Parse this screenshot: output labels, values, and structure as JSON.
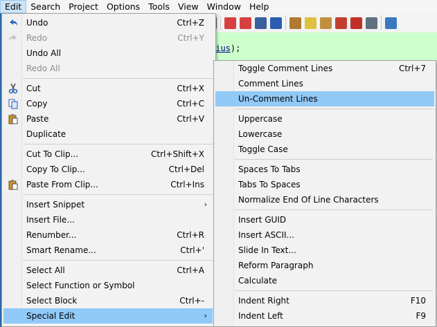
{
  "menubar": [
    "Edit",
    "Search",
    "Project",
    "Options",
    "Tools",
    "View",
    "Window",
    "Help"
  ],
  "editor": {
    "code_tail": "dius",
    "code_end": ");"
  },
  "edit_menu": {
    "undo": {
      "label": "Undo",
      "shortcut": "Ctrl+Z"
    },
    "redo": {
      "label": "Redo",
      "shortcut": "Ctrl+Y"
    },
    "undo_all": {
      "label": "Undo All"
    },
    "redo_all": {
      "label": "Redo All"
    },
    "cut": {
      "label": "Cut",
      "shortcut": "Ctrl+X"
    },
    "copy": {
      "label": "Copy",
      "shortcut": "Ctrl+C"
    },
    "paste": {
      "label": "Paste",
      "shortcut": "Ctrl+V"
    },
    "duplicate": {
      "label": "Duplicate"
    },
    "cut_to_clip": {
      "label": "Cut To Clip...",
      "shortcut": "Ctrl+Shift+X"
    },
    "copy_to_clip": {
      "label": "Copy To Clip...",
      "shortcut": "Ctrl+Del"
    },
    "paste_from_clip": {
      "label": "Paste From Clip...",
      "shortcut": "Ctrl+Ins"
    },
    "insert_snippet": {
      "label": "Insert Snippet"
    },
    "insert_file": {
      "label": "Insert File..."
    },
    "renumber": {
      "label": "Renumber...",
      "shortcut": "Ctrl+R"
    },
    "smart_rename": {
      "label": "Smart Rename...",
      "shortcut": "Ctrl+'"
    },
    "select_all": {
      "label": "Select All",
      "shortcut": "Ctrl+A"
    },
    "select_function": {
      "label": "Select Function or Symbol"
    },
    "select_block": {
      "label": "Select Block",
      "shortcut": "Ctrl+-"
    },
    "special_edit": {
      "label": "Special Edit"
    }
  },
  "special_edit_menu": {
    "toggle_comment": {
      "label": "Toggle Comment Lines",
      "shortcut": "Ctrl+7"
    },
    "comment": {
      "label": "Comment Lines"
    },
    "uncomment": {
      "label": "Un-Comment Lines"
    },
    "uppercase": {
      "label": "Uppercase"
    },
    "lowercase": {
      "label": "Lowercase"
    },
    "toggle_case": {
      "label": "Toggle Case"
    },
    "spaces_to_tabs": {
      "label": "Spaces To Tabs"
    },
    "tabs_to_spaces": {
      "label": "Tabs To Spaces"
    },
    "normalize_eol": {
      "label": "Normalize End Of Line Characters"
    },
    "insert_guid": {
      "label": "Insert GUID"
    },
    "insert_ascii": {
      "label": "Insert ASCII..."
    },
    "slide_in_text": {
      "label": "Slide In Text..."
    },
    "reform_paragraph": {
      "label": "Reform Paragraph"
    },
    "calculate": {
      "label": "Calculate"
    },
    "indent_right": {
      "label": "Indent Right",
      "shortcut": "F10"
    },
    "indent_left": {
      "label": "Indent Left",
      "shortcut": "F9"
    }
  },
  "colors": {
    "highlight": "#91c9f7",
    "editor_bg": "#ccffcc",
    "disabled": "#8d8d8d"
  },
  "icons": [
    "undo-icon",
    "redo-icon",
    "cut-icon",
    "copy-icon",
    "paste-icon",
    "paste-from-clip-icon",
    "submenu-arrow-icon"
  ]
}
